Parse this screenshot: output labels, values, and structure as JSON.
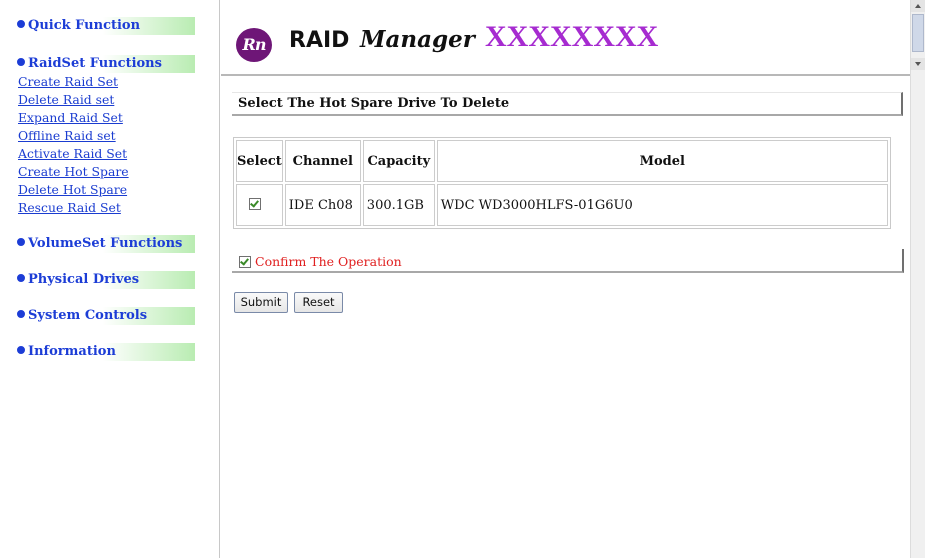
{
  "sidebar": {
    "sections": [
      {
        "label": "Quick Function"
      },
      {
        "label": "RaidSet Functions"
      },
      {
        "label": "VolumeSet Functions"
      },
      {
        "label": "Physical Drives"
      },
      {
        "label": "System Controls"
      },
      {
        "label": "Information"
      }
    ],
    "raidset_links": [
      "Create Raid Set",
      "Delete Raid set",
      "Expand Raid Set",
      "Offline Raid set",
      "Activate Raid Set",
      "Create Hot Spare",
      "Delete Hot Spare",
      "Rescue Raid Set"
    ]
  },
  "header": {
    "logo_badge": "Rn",
    "logo_raid": "RAID",
    "logo_manager": "Manager",
    "model_name": "XXXXXXXX"
  },
  "main": {
    "title": "Select The Hot Spare Drive To Delete",
    "table": {
      "headers": [
        "Select",
        "Channel",
        "Capacity",
        "Model"
      ],
      "rows": [
        {
          "selected": true,
          "channel": "IDE Ch08",
          "capacity": "300.1GB",
          "model": "WDC WD3000HLFS-01G6U0"
        }
      ]
    },
    "confirm_label": "Confirm The Operation",
    "confirm_checked": true,
    "submit_label": "Submit",
    "reset_label": "Reset"
  },
  "colors": {
    "link": "#1a3cd0",
    "section_gradient": "#b9ecb2",
    "model_name": "#a62bd0",
    "logo_badge": "#6e1677",
    "confirm_text": "#e02020"
  }
}
